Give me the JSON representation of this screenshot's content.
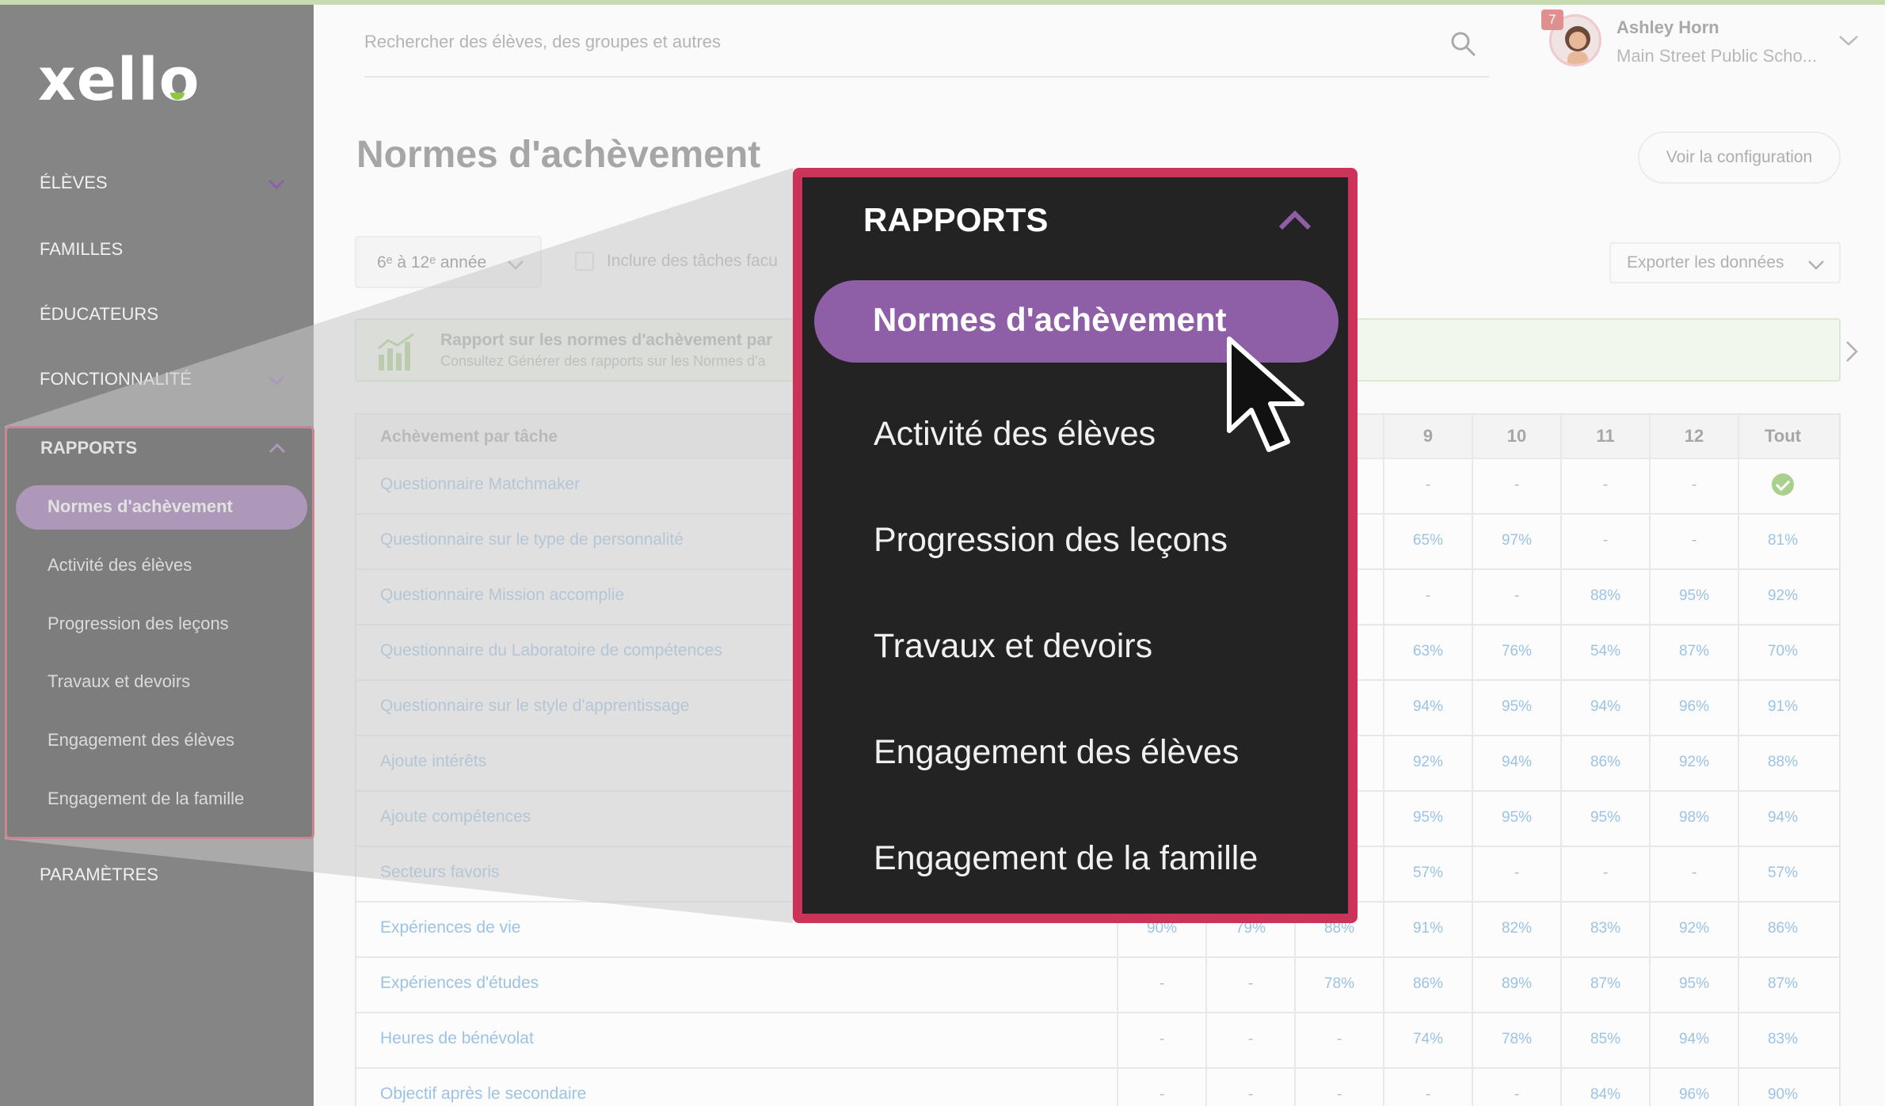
{
  "sidebar": {
    "logo": "xello",
    "items": [
      {
        "label": "ÉLÈVES"
      },
      {
        "label": "FAMILLES"
      },
      {
        "label": "ÉDUCATEURS"
      },
      {
        "label": "FONCTIONNALITÉ"
      },
      {
        "label": "PARAMÈTRES"
      }
    ],
    "rapports": {
      "label": "RAPPORTS",
      "items": [
        {
          "label": "Normes d'achèvement"
        },
        {
          "label": "Activité des élèves"
        },
        {
          "label": "Progression des leçons"
        },
        {
          "label": "Travaux et devoirs"
        },
        {
          "label": "Engagement des élèves"
        },
        {
          "label": "Engagement de la famille"
        }
      ]
    }
  },
  "header": {
    "search_placeholder": "Rechercher des élèves, des groupes et autres",
    "notification_count": "7",
    "user_name": "Ashley Horn",
    "user_school": "Main Street Public Scho..."
  },
  "main": {
    "title": "Normes d'achèvement",
    "config_button": "Voir la configuration",
    "grade_select": "6ᵉ à 12ᵉ année",
    "include_optional": "Inclure des tâches facu",
    "export_button": "Exporter les données",
    "banner_title": "Rapport sur les normes d'achèvement par",
    "banner_sub": "Consultez Générer des rapports sur les Normes d'a"
  },
  "table": {
    "header_label": "Achèvement par tâche",
    "columns": [
      "",
      "",
      "",
      "9",
      "10",
      "11",
      "12",
      "Tout"
    ],
    "rows": [
      {
        "label": "Questionnaire Matchmaker",
        "cells": [
          "",
          "",
          "",
          "-",
          "-",
          "-",
          "-",
          "check"
        ]
      },
      {
        "label": "Questionnaire sur le type de personnalité",
        "cells": [
          "",
          "",
          "",
          "65%",
          "97%",
          "-",
          "-",
          "81%"
        ]
      },
      {
        "label": "Questionnaire Mission accomplie",
        "cells": [
          "",
          "",
          "",
          "-",
          "-",
          "88%",
          "95%",
          "92%"
        ]
      },
      {
        "label": "Questionnaire du Laboratoire de compétences",
        "cells": [
          "",
          "",
          "",
          "63%",
          "76%",
          "54%",
          "87%",
          "70%"
        ]
      },
      {
        "label": "Questionnaire sur le style d'apprentissage",
        "cells": [
          "",
          "",
          "",
          "94%",
          "95%",
          "94%",
          "96%",
          "91%"
        ]
      },
      {
        "label": "Ajoute intérêts",
        "cells": [
          "",
          "",
          "",
          "92%",
          "94%",
          "86%",
          "92%",
          "88%"
        ]
      },
      {
        "label": "Ajoute compétences",
        "cells": [
          "",
          "",
          "",
          "95%",
          "95%",
          "95%",
          "98%",
          "94%"
        ]
      },
      {
        "label": "Secteurs favoris",
        "cells": [
          "",
          "",
          "",
          "57%",
          "-",
          "-",
          "-",
          "57%"
        ]
      },
      {
        "label": "Expériences de vie",
        "cells": [
          "90%",
          "79%",
          "88%",
          "91%",
          "82%",
          "83%",
          "92%",
          "86%"
        ]
      },
      {
        "label": "Expériences d'études",
        "cells": [
          "-",
          "-",
          "78%",
          "86%",
          "89%",
          "87%",
          "95%",
          "87%"
        ]
      },
      {
        "label": "Heures de bénévolat",
        "cells": [
          "-",
          "-",
          "-",
          "74%",
          "78%",
          "85%",
          "94%",
          "83%"
        ]
      },
      {
        "label": "Objectif après le secondaire",
        "cells": [
          "-",
          "-",
          "-",
          "-",
          "-",
          "84%",
          "96%",
          "90%"
        ]
      }
    ]
  },
  "colors": {
    "accent_purple": "#8e5ea6",
    "highlight_border": "#cb3458",
    "dark_panel": "#232323",
    "link_blue": "#9cc3e4"
  }
}
